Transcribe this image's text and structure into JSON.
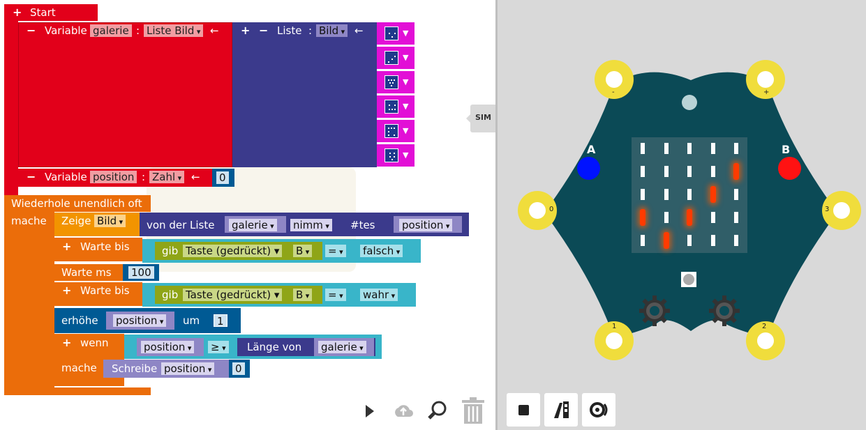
{
  "blocks": {
    "start": {
      "plus": "+",
      "label": "Start"
    },
    "var_galerie": {
      "minus": "−",
      "keyword": "Variable",
      "name": "galerie",
      "colon": ":",
      "type": "Liste Bild",
      "arrow": "←"
    },
    "liste": {
      "plus": "+",
      "minus": "−",
      "keyword": "Liste",
      "colon": ":",
      "type": "Bild",
      "arrow": "←"
    },
    "var_position": {
      "minus": "−",
      "keyword": "Variable",
      "name": "position",
      "colon": ":",
      "type": "Zahl",
      "arrow": "←",
      "value": "0"
    },
    "loop": {
      "label": "Wiederhole unendlich oft",
      "do": "mache"
    },
    "zeige": {
      "keyword": "Zeige",
      "type": "Bild",
      "from_list": "von der Liste",
      "list": "galerie",
      "op": "nimm",
      "hash": "#tes",
      "index": "position"
    },
    "warte_bis_1": {
      "plus": "+",
      "keyword": "Warte bis",
      "gib": "gib",
      "sensor": "Taste",
      "state": "(gedrückt)",
      "button": "B",
      "eq": "=",
      "value": "falsch"
    },
    "warte_ms": {
      "keyword": "Warte ms",
      "value": "100"
    },
    "warte_bis_2": {
      "plus": "+",
      "keyword": "Warte bis",
      "gib": "gib",
      "sensor": "Taste",
      "state": "(gedrückt)",
      "button": "B",
      "eq": "=",
      "value": "wahr"
    },
    "erhoehe": {
      "keyword": "erhöhe",
      "var": "position",
      "um": "um",
      "value": "1"
    },
    "wenn": {
      "plus": "+",
      "keyword": "wenn",
      "var": "position",
      "cmp": "≥",
      "len": "Länge von",
      "list": "galerie",
      "do": "mache",
      "set": "Schreibe",
      "set_var": "position",
      "set_value": "0"
    }
  },
  "toolbar": {
    "run_icon": "play-icon",
    "upload_icon": "cloud-upload-icon",
    "zoom_icon": "zoom-icon",
    "trash_icon": "trash-icon"
  },
  "sim_tab": {
    "label": "SIM"
  },
  "board": {
    "button_a": "A",
    "button_b": "B",
    "pads": {
      "minus": "-",
      "plus": "+",
      "p0": "0",
      "p1": "1",
      "p2": "2",
      "p3": "3"
    },
    "led_grid_description_lit": [
      [
        0,
        0,
        0,
        0,
        0
      ],
      [
        0,
        0,
        0,
        0,
        1
      ],
      [
        0,
        0,
        0,
        1,
        0
      ],
      [
        1,
        0,
        1,
        0,
        0
      ],
      [
        0,
        1,
        0,
        0,
        0
      ]
    ]
  },
  "sim_controls": {
    "stop_icon": "stop-icon",
    "debug_icon": "debug-icon",
    "sound_icon": "sound-icon"
  },
  "colors": {
    "start_red": "#e2001a",
    "list_blue": "#3b3a8c",
    "loop_orange": "#eb6d0a",
    "zeige_orange": "#f29400",
    "sensor_teal": "#39b5c9",
    "sensor_green": "#8fa517",
    "var_purple": "#8e86c5",
    "num_navy": "#005a94",
    "image_magenta": "#e20fd6",
    "board_teal": "#0b4a56"
  }
}
